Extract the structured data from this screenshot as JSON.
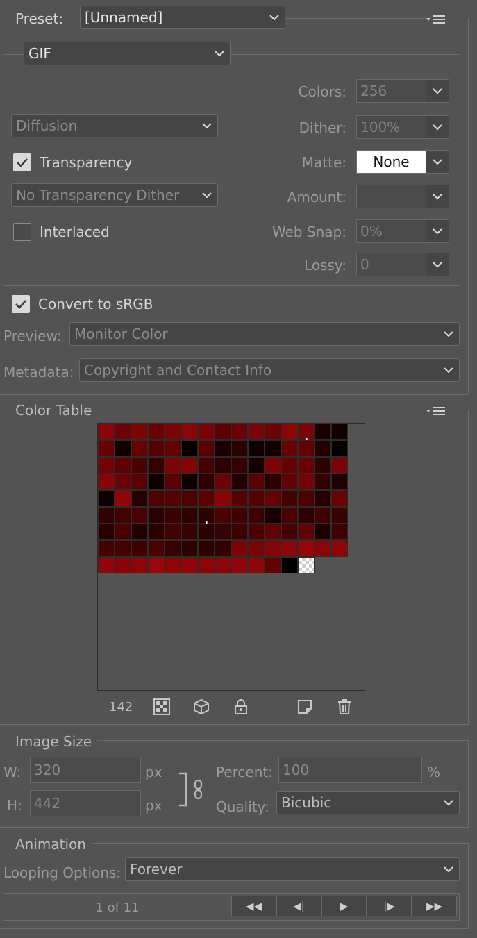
{
  "preset": {
    "label": "Preset:",
    "value": "[Unnamed]"
  },
  "format": {
    "value": "GIF"
  },
  "gif_options": {
    "colors_label": "Colors:",
    "colors_value": "256",
    "dither_label": "Dither:",
    "dither_value": "100%",
    "matte_label": "Matte:",
    "matte_value": "None",
    "amount_label": "Amount:",
    "amount_value": "",
    "websnap_label": "Web Snap:",
    "websnap_value": "0%",
    "lossy_label": "Lossy:",
    "lossy_value": "0",
    "dither_algorithm": "Diffusion",
    "transparency_label": "Transparency",
    "transparency_checked": true,
    "transparency_dither": "No Transparency Dither",
    "interlaced_label": "Interlaced",
    "interlaced_checked": false
  },
  "convert_srgb": {
    "label": "Convert to sRGB",
    "checked": true
  },
  "preview": {
    "label": "Preview:",
    "value": "Monitor Color"
  },
  "metadata": {
    "label": "Metadata:",
    "value": "Copyright and Contact Info"
  },
  "color_table": {
    "title": "Color Table",
    "count": "142",
    "colors": [
      "#8a0306",
      "#6e0103",
      "#7c0405",
      "#6a0204",
      "#7d0305",
      "#8c0406",
      "#7a0204",
      "#5e0103",
      "#6a0203",
      "#7d0406",
      "#6a0304",
      "#8d0407",
      "#790305",
      "#1a0000",
      "#150000",
      "#6a0103",
      "#110000",
      "#680203",
      "#520104",
      "#620203",
      "#050000",
      "#5a0103",
      "#1a0000",
      "#2b0000",
      "#0d0000",
      "#140000",
      "#690203",
      "#600203",
      "#200000",
      "#070000",
      "#720204",
      "#5d0103",
      "#4a0102",
      "#330000",
      "#7e0305",
      "#840406",
      "#450101",
      "#2c0000",
      "#380101",
      "#130000",
      "#7e0305",
      "#660204",
      "#690203",
      "#2f0000",
      "#7c0305",
      "#8a0407",
      "#6b0204",
      "#5a0103",
      "#0c0000",
      "#5a0103",
      "#0f0000",
      "#2b0000",
      "#6c0204",
      "#200000",
      "#590103",
      "#2d0000",
      "#630204",
      "#740305",
      "#310000",
      "#1d0000",
      "#0c0000",
      "#920508",
      "#290000",
      "#4e0102",
      "#530102",
      "#4d0102",
      "#5b0103",
      "#8a0406",
      "#550102",
      "#540102",
      "#650203",
      "#430101",
      "#4b0102",
      "#260000",
      "#6e0203",
      "#330000",
      "#3f0101",
      "#4b0102",
      "#2a0000",
      "#3b0101",
      "#2f0000",
      "#2d0000",
      "#4b0102",
      "#420101",
      "#3d0101",
      "#190000",
      "#4a0102",
      "#2c0000",
      "#410101",
      "#3a0101",
      "#280000",
      "#470101",
      "#230000",
      "#290000",
      "#3f0101",
      "#380101",
      "#2c0000",
      "#360101",
      "#3d0101",
      "#4a0102",
      "#5f0203",
      "#450101",
      "#610203",
      "#1a0000",
      "#3e0101",
      "#450101",
      "#430101",
      "#3e0101",
      "#490102",
      "#360101",
      "#2b0000",
      "#2c0000",
      "#330000",
      "#7f0305",
      "#7b0305",
      "#870406",
      "#8d0406",
      "#980609",
      "#8d0406",
      "#8f0506",
      "#930508",
      "#8a0406",
      "#8f0506",
      "#9a0609",
      "#8e0506",
      "#930508",
      "#8c0406",
      "#8b0406",
      "#910508",
      "#8e0506",
      "#620203",
      "#000000",
      "checker"
    ],
    "marked_cells": [
      12,
      81,
      136
    ]
  },
  "image_size": {
    "title": "Image Size",
    "w_label": "W:",
    "w_value": "320",
    "w_unit": "px",
    "h_label": "H:",
    "h_value": "442",
    "h_unit": "px",
    "percent_label": "Percent:",
    "percent_value": "100",
    "percent_unit": "%",
    "quality_label": "Quality:",
    "quality_value": "Bicubic"
  },
  "animation": {
    "title": "Animation",
    "looping_label": "Looping Options:",
    "looping_value": "Forever",
    "frame_counter": "1 of 11",
    "buttons": [
      "◀◀",
      "◀|",
      "▶",
      "|▶",
      "▶▶"
    ]
  }
}
